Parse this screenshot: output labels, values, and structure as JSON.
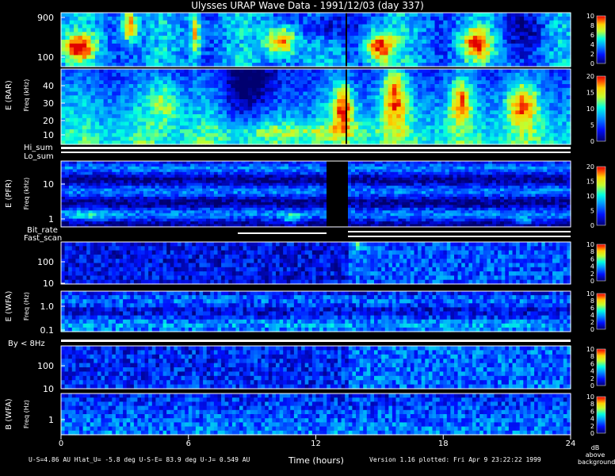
{
  "chart_data": {
    "type": "heatmap",
    "title": "Ulysses URAP Wave Data - 1991/12/03  (day 337)",
    "xlabel": "Time (hours)",
    "x_ticks": [
      "0",
      "6",
      "12",
      "18",
      "24"
    ],
    "xlim": [
      0,
      24
    ],
    "panels": [
      {
        "id": "rar",
        "ylabel": "E (RAR)",
        "unit_label": "Freq (kHz)",
        "sub_panels": [
          {
            "y_ticks": [
              "900",
              "100"
            ],
            "ylim_khz": [
              55,
              1000
            ],
            "y_scale": "log"
          },
          {
            "y_ticks": [
              "40",
              "30",
              "20",
              "10"
            ],
            "ylim_khz": [
              1,
              50
            ],
            "y_scale": "linear"
          }
        ],
        "colorbars": [
          {
            "ticks": [
              "10",
              "8",
              "6",
              "4",
              "2",
              "0"
            ],
            "range": [
              0,
              10
            ]
          },
          {
            "ticks": [
              "20",
              "15",
              "10",
              "5",
              "0"
            ],
            "range": [
              0,
              20
            ]
          }
        ]
      },
      {
        "id": "pfr",
        "status_labels": [
          "Hi_sum",
          "Lo_sum"
        ],
        "ylabel": "E (PFR)",
        "unit_label": "Freq (kHz)",
        "y_ticks": [
          "10",
          "1"
        ],
        "y_scale": "log",
        "colorbar": {
          "ticks": [
            "20",
            "15",
            "10",
            "5",
            "0"
          ],
          "range": [
            0,
            20
          ]
        }
      },
      {
        "id": "wfa_e",
        "status_labels": [
          "Bit_rate",
          "Fast_scan"
        ],
        "ylabel": "E (WFA)",
        "unit_label": "Freq (Hz)",
        "sub_panels": [
          {
            "y_ticks": [
              "100",
              "10"
            ],
            "y_scale": "log"
          },
          {
            "y_ticks": [
              "1.0",
              "0.1"
            ],
            "y_scale": "log"
          }
        ],
        "colorbars": [
          {
            "ticks": [
              "10",
              "8",
              "6",
              "4",
              "2",
              "0"
            ],
            "range": [
              0,
              10
            ]
          },
          {
            "ticks": [
              "10",
              "8",
              "6",
              "4",
              "2",
              "0"
            ],
            "range": [
              0,
              10
            ]
          }
        ]
      },
      {
        "id": "wfa_b",
        "status_labels": [
          "By < 8Hz"
        ],
        "ylabel": "B (WFA)",
        "unit_label": "Freq (Hz)",
        "sub_panels": [
          {
            "y_ticks": [
              "100",
              "10"
            ],
            "y_scale": "log"
          },
          {
            "y_ticks": [
              "1"
            ],
            "y_scale": "log"
          }
        ],
        "colorbars": [
          {
            "ticks": [
              "10",
              "8",
              "6",
              "4",
              "2",
              "0"
            ],
            "range": [
              0,
              10
            ]
          },
          {
            "ticks": [
              "10",
              "8",
              "6",
              "4",
              "2",
              "0"
            ],
            "range": [
              0,
              10
            ]
          }
        ]
      }
    ],
    "colorbar_unit": [
      "dB",
      "above",
      "background"
    ],
    "footer_left": "U-S=4.86 AU  Hlat_U= -5.8 deg  U-S-E= 83.9 deg  U-J= 0.549 AU",
    "footer_right": "Version 1.16 plotted: Fri Apr  9 23:22:22 1999"
  }
}
